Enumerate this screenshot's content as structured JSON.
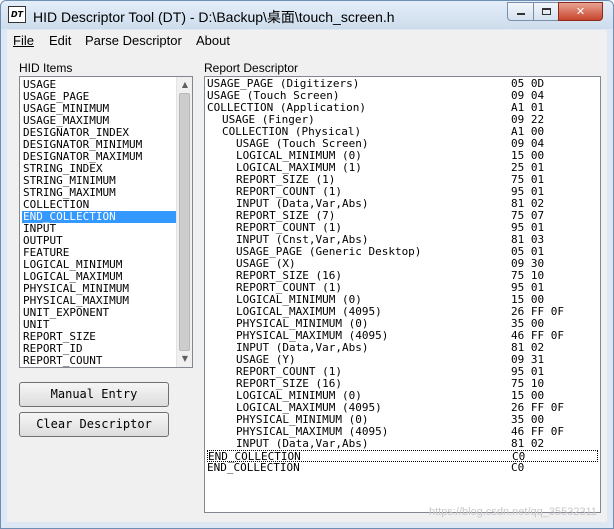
{
  "window": {
    "icon_label": "DT",
    "title": "HID Descriptor Tool (DT) - D:\\Backup\\桌面\\touch_screen.h",
    "minimize_glyph": "",
    "maximize_glyph": "",
    "close_glyph": "✕"
  },
  "menu": {
    "items": [
      {
        "label": "File"
      },
      {
        "label": "Edit"
      },
      {
        "label": "Parse Descriptor"
      },
      {
        "label": "About"
      }
    ]
  },
  "hid_items": {
    "label": "HID Items",
    "selected_index": 11,
    "items": [
      "USAGE",
      "USAGE_PAGE",
      "USAGE_MINIMUM",
      "USAGE_MAXIMUM",
      "DESIGNATOR_INDEX",
      "DESIGNATOR_MINIMUM",
      "DESIGNATOR_MAXIMUM",
      "STRING_INDEX",
      "STRING_MINIMUM",
      "STRING_MAXIMUM",
      "COLLECTION",
      "END_COLLECTION",
      "INPUT",
      "OUTPUT",
      "FEATURE",
      "LOGICAL_MINIMUM",
      "LOGICAL_MAXIMUM",
      "PHYSICAL_MINIMUM",
      "PHYSICAL_MAXIMUM",
      "UNIT_EXPONENT",
      "UNIT",
      "REPORT_SIZE",
      "REPORT_ID",
      "REPORT_COUNT"
    ]
  },
  "buttons": {
    "manual_entry": "Manual Entry",
    "clear_descriptor": "Clear Descriptor"
  },
  "report": {
    "label": "Report Descriptor",
    "focused_index": 31,
    "rows": [
      {
        "text": "USAGE_PAGE (Digitizers)",
        "indent": 0,
        "hex": "05 0D"
      },
      {
        "text": "USAGE (Touch Screen)",
        "indent": 0,
        "hex": "09 04"
      },
      {
        "text": "COLLECTION (Application)",
        "indent": 0,
        "hex": "A1 01"
      },
      {
        "text": "USAGE (Finger)",
        "indent": 1,
        "hex": "09 22"
      },
      {
        "text": "COLLECTION (Physical)",
        "indent": 1,
        "hex": "A1 00"
      },
      {
        "text": "USAGE (Touch Screen)",
        "indent": 2,
        "hex": "09 04"
      },
      {
        "text": "LOGICAL_MINIMUM (0)",
        "indent": 2,
        "hex": "15 00"
      },
      {
        "text": "LOGICAL_MAXIMUM (1)",
        "indent": 2,
        "hex": "25 01"
      },
      {
        "text": "REPORT_SIZE (1)",
        "indent": 2,
        "hex": "75 01"
      },
      {
        "text": "REPORT_COUNT (1)",
        "indent": 2,
        "hex": "95 01"
      },
      {
        "text": "INPUT (Data,Var,Abs)",
        "indent": 2,
        "hex": "81 02"
      },
      {
        "text": "REPORT_SIZE (7)",
        "indent": 2,
        "hex": "75 07"
      },
      {
        "text": "REPORT_COUNT (1)",
        "indent": 2,
        "hex": "95 01"
      },
      {
        "text": "INPUT (Cnst,Var,Abs)",
        "indent": 2,
        "hex": "81 03"
      },
      {
        "text": "USAGE_PAGE (Generic Desktop)",
        "indent": 2,
        "hex": "05 01"
      },
      {
        "text": "USAGE (X)",
        "indent": 2,
        "hex": "09 30"
      },
      {
        "text": "REPORT_SIZE (16)",
        "indent": 2,
        "hex": "75 10"
      },
      {
        "text": "REPORT_COUNT (1)",
        "indent": 2,
        "hex": "95 01"
      },
      {
        "text": "LOGICAL_MINIMUM (0)",
        "indent": 2,
        "hex": "15 00"
      },
      {
        "text": "LOGICAL_MAXIMUM (4095)",
        "indent": 2,
        "hex": "26 FF 0F"
      },
      {
        "text": "PHYSICAL_MINIMUM (0)",
        "indent": 2,
        "hex": "35 00"
      },
      {
        "text": "PHYSICAL_MAXIMUM (4095)",
        "indent": 2,
        "hex": "46 FF 0F"
      },
      {
        "text": "INPUT (Data,Var,Abs)",
        "indent": 2,
        "hex": "81 02"
      },
      {
        "text": "USAGE (Y)",
        "indent": 2,
        "hex": "09 31"
      },
      {
        "text": "REPORT_COUNT (1)",
        "indent": 2,
        "hex": "95 01"
      },
      {
        "text": "REPORT_SIZE (16)",
        "indent": 2,
        "hex": "75 10"
      },
      {
        "text": "LOGICAL_MINIMUM (0)",
        "indent": 2,
        "hex": "15 00"
      },
      {
        "text": "LOGICAL_MAXIMUM (4095)",
        "indent": 2,
        "hex": "26 FF 0F"
      },
      {
        "text": "PHYSICAL_MINIMUM (0)",
        "indent": 2,
        "hex": "35 00"
      },
      {
        "text": "PHYSICAL_MAXIMUM (4095)",
        "indent": 2,
        "hex": "46 FF 0F"
      },
      {
        "text": "INPUT (Data,Var,Abs)",
        "indent": 2,
        "hex": "81 02"
      },
      {
        "text": "END_COLLECTION",
        "indent": 0,
        "hex": "C0"
      },
      {
        "text": "END_COLLECTION",
        "indent": 0,
        "hex": "C0"
      }
    ]
  },
  "watermark": "https://blog.csdn.net/qq_35532311"
}
